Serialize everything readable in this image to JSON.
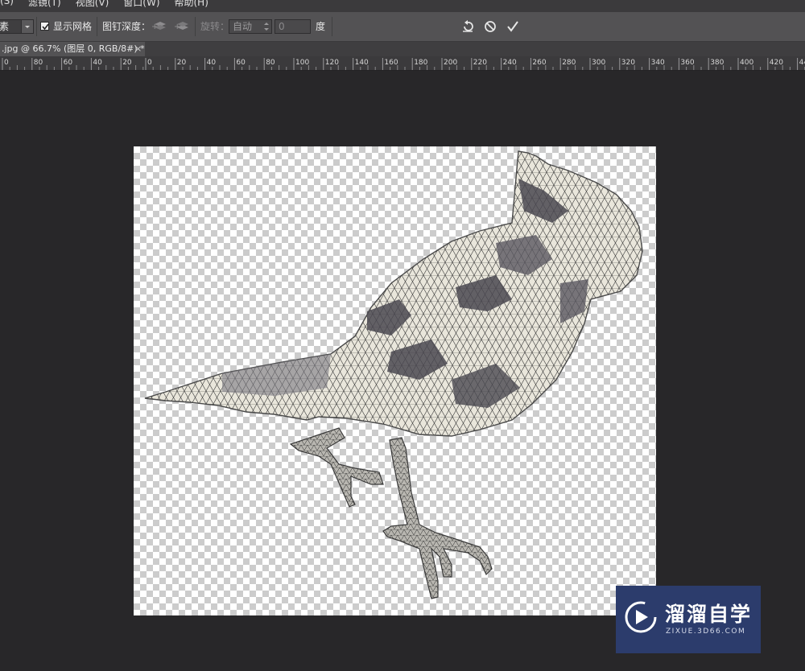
{
  "menubar": {
    "items": [
      "(S)",
      "滤镜(T)",
      "视图(V)",
      "窗口(W)",
      "帮助(H)"
    ]
  },
  "options": {
    "density_value": "素",
    "show_mesh_label": "显示网格",
    "show_mesh_checked": true,
    "pin_depth_label": "图钉深度：",
    "rotate_label": "旋转：",
    "rotate_mode": "自动",
    "rotate_angle": "0",
    "degree_label": "度"
  },
  "tab": {
    "title": ".jpg @ 66.7% (图层 0, RGB/8#) *",
    "close": "×"
  },
  "ruler": {
    "labels": [
      "0",
      "80",
      "60",
      "40",
      "20",
      "0",
      "20",
      "40",
      "60",
      "80",
      "100",
      "120",
      "140",
      "160",
      "180",
      "200",
      "220",
      "240",
      "260",
      "280",
      "300",
      "320",
      "340",
      "360",
      "380",
      "400",
      "420",
      "440"
    ]
  },
  "watermark": {
    "title": "溜溜自学",
    "subtitle": "ZIXUE.3D66.COM"
  },
  "icons": {
    "undo": "undo-icon",
    "cancel": "cancel-icon",
    "commit": "checkmark-icon"
  }
}
